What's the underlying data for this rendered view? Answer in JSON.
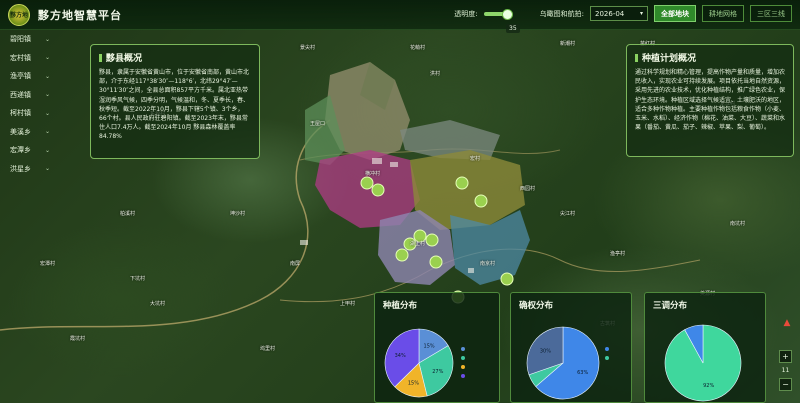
{
  "app": {
    "title": "黟方地智慧平台",
    "logo_text": "黟方地"
  },
  "toolbar": {
    "opacity_label": "透明度:",
    "opacity_value": "35",
    "date_label": "乌瞰图和航拍:",
    "date_value": "2026-04",
    "buttons": [
      {
        "label": "全部地块",
        "active": true
      },
      {
        "label": "耕地网格",
        "active": false
      },
      {
        "label": "三区三线",
        "active": false
      }
    ]
  },
  "sidebar": {
    "items": [
      "碧阳镇",
      "宏村镇",
      "渔亭镇",
      "西递镇",
      "柯村镇",
      "美溪乡",
      "宏潭乡",
      "洪星乡"
    ]
  },
  "overview": {
    "title": "黟县概况",
    "text": "黟县，隶属于安徽省黄山市，位于安徽省南部，黄山市北部，介于东经117°38′30″—118°6′，北纬29°47′—30°11′30″之间，全县总面积857平方千米。属北亚热带湿润季风气候，四季分明，气候温和，冬、夏季长，春、秋季短。截至2022年10月，黟县下辖5个镇、3个乡，66个村。县人民政府驻碧阳镇。截至2023年末，黟县常住人口7.4万人。截至2024年10月 黟县森林覆盖率84.78%"
  },
  "plan": {
    "title": "种植计划概况",
    "text": "通过科学规划和精心管理，提高作物产量和质量，增加农民收入，实现农业可持续发展。项目依托当地自然资源，采用先进的农业技术，优化种植结构，推广绿色农业，保护生态环境。种植区域选择气候适宜、土壤肥沃的地区，适合多种作物种植。主要种植作物包括粮食作物（小麦、玉米、水稻）、经济作物（棉花、油菜、大豆）、蔬菜和水果（番茄、黄瓜、茄子、辣椒、苹果、梨、葡萄）。"
  },
  "map_labels": [
    "景尖村",
    "花萌村",
    "苗红村",
    "新潮村",
    "龙江村",
    "王屋口",
    "洪村",
    "南屏",
    "西园村",
    "横冲村",
    "尖江村",
    "宏村",
    "渔亭村",
    "南坑村",
    "湖上村",
    "上甲村",
    "南京村",
    "坤沙村",
    "东源村",
    "柏溪村",
    "宏潭村",
    "下坑村",
    "美源村",
    "江口村",
    "古筑村",
    "大坑村",
    "霞坑村",
    "坞里村"
  ],
  "map_controls": {
    "zoom_level": "11",
    "compass": "N"
  },
  "chart_data": [
    {
      "type": "pie",
      "title": "种植分布",
      "values": [
        15,
        27,
        15,
        34
      ],
      "labels": [
        "15%",
        "27%",
        "15%",
        "34%"
      ],
      "colors": [
        "#5a8fd6",
        "#3ec9a0",
        "#f0b429",
        "#6a4de8"
      ],
      "legend": [
        "",
        "",
        "",
        ""
      ]
    },
    {
      "type": "pie",
      "title": "确权分布",
      "values": [
        63,
        6,
        30
      ],
      "labels": [
        "63%",
        "",
        "30%"
      ],
      "colors": [
        "#3f87e8",
        "#3ec9a0",
        "#4b6a9a"
      ],
      "legend": [
        "",
        ""
      ]
    },
    {
      "type": "pie",
      "title": "三调分布",
      "values": [
        92,
        8
      ],
      "labels": [
        "92%",
        ""
      ],
      "colors": [
        "#3fd79d",
        "#3f87e8"
      ]
    }
  ],
  "colors": {
    "accent": "#2f8a2a",
    "panel_border": "#7db85c"
  }
}
